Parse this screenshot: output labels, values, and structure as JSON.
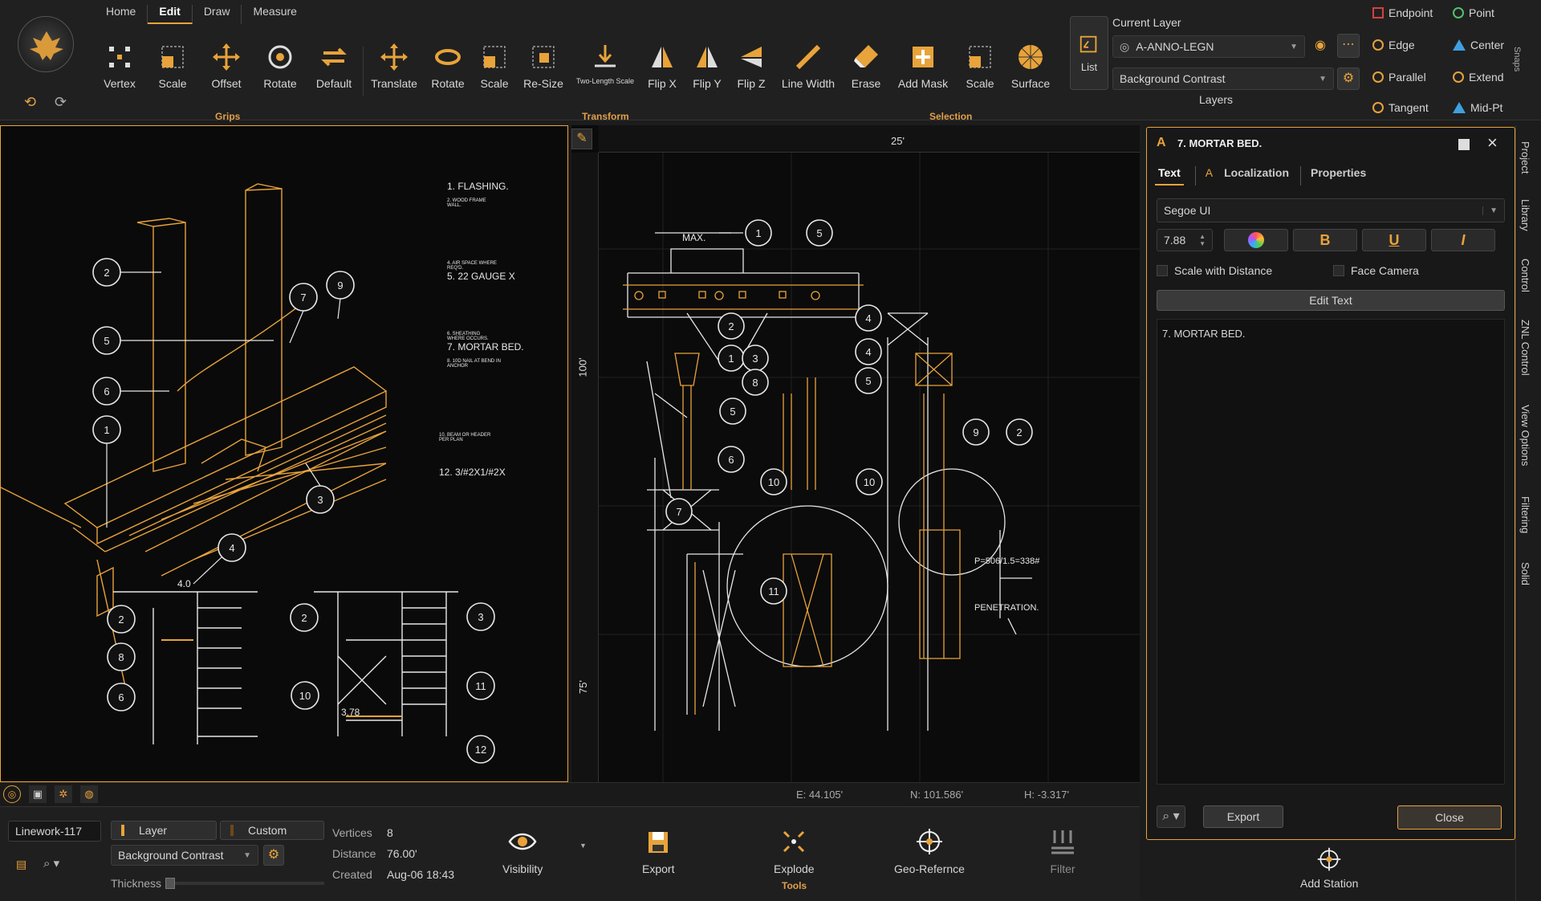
{
  "menu": {
    "tabs": [
      "Home",
      "Edit",
      "Draw",
      "Measure"
    ],
    "active": "Edit"
  },
  "toolbar": {
    "grips": {
      "label": "Grips",
      "items": [
        "Vertex",
        "Scale",
        "Offset",
        "Rotate",
        "Default"
      ]
    },
    "transform": {
      "label": "Transform",
      "items": [
        "Translate",
        "Rotate",
        "Scale",
        "Re-Size",
        "Two-Length Scale",
        "Flip X",
        "Flip Y",
        "Flip Z",
        "Line Width",
        "Erase"
      ]
    },
    "selection": {
      "label": "Selection",
      "items": [
        "Add Mask",
        "Scale",
        "Surface"
      ]
    },
    "list_label": "List"
  },
  "layers": {
    "title": "Current Layer",
    "current": "A-ANNO-LEGN",
    "style": "Background Contrast",
    "label": "Layers"
  },
  "snaps": {
    "items": [
      "Endpoint",
      "Point",
      "Edge",
      "Center",
      "Parallel",
      "Extend",
      "Tangent",
      "Mid-Pt"
    ],
    "label": "Snaps"
  },
  "sheet_notes": [
    "1. FLASHING.",
    "2. WOOD FRAME WALL.",
    "4. AIR SPACE WHERE REQ'D.",
    "5. 22 GAUGE X",
    "6. SHEATHING WHERE OCCURS.",
    "7. MORTAR BED.",
    "8. 10D NAIL AT BEND IN ANCHOR",
    "10. BEAM OR HEADER PER PLAN",
    "12. 3/#2X1/#2X"
  ],
  "drawing_left": {
    "callouts_top": [
      "2",
      "5",
      "6",
      "1",
      "7",
      "9",
      "3",
      "4"
    ],
    "callouts_bottom": [
      "2",
      "8",
      "6",
      "2",
      "10",
      "3",
      "11",
      "12"
    ],
    "labels": [
      "4.0",
      "3.78"
    ]
  },
  "drawing_right": {
    "ruler_top": "25'",
    "ruler_left": [
      "100'",
      "75'"
    ],
    "callouts": [
      "1",
      "5",
      "2",
      "1",
      "3",
      "8",
      "4",
      "4",
      "5",
      "5",
      "6",
      "7",
      "10",
      "10",
      "9",
      "2",
      "11"
    ],
    "labels": [
      "MAX.",
      "P=506/1.5=338#",
      "PENETRATION."
    ],
    "status": {
      "e": "E: 44.105'",
      "n": "N: 101.586'",
      "h": "H: -3.317'"
    }
  },
  "text_panel": {
    "title": "7. MORTAR BED.",
    "tabs": [
      "Text",
      "Localization",
      "Properties"
    ],
    "font": "Segoe UI",
    "size": "7.88",
    "scale_with_distance": "Scale with Distance",
    "face_camera": "Face Camera",
    "edit_text": "Edit Text",
    "content": "7. MORTAR BED.",
    "export": "Export",
    "close": "Close"
  },
  "side_tabs": [
    "Project",
    "Library",
    "Control",
    "ZNL Control",
    "View Options",
    "Filtering",
    "Solid"
  ],
  "bottom": {
    "name": "Linework-117",
    "layer_btn": "Layer",
    "custom_btn": "Custom",
    "style": "Background Contrast",
    "thickness": "Thickness",
    "vertices_label": "Vertices",
    "vertices": "8",
    "distance_label": "Distance",
    "distance": "76.00'",
    "created_label": "Created",
    "created": "Aug-06 18:43",
    "tools": [
      "Visibility",
      "Export",
      "Explode",
      "Geo-Refernce",
      "Filter"
    ],
    "tools_label": "Tools",
    "add_station": "Add Station"
  },
  "colors": {
    "accent": "#e8a33a",
    "bg": "#1c1c1c",
    "canvas": "#0b0b0b",
    "line": "#e8e8e8"
  }
}
